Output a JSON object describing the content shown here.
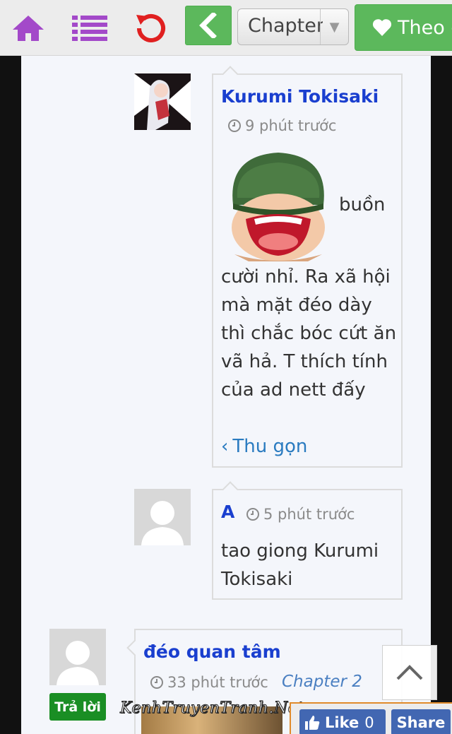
{
  "toolbar": {
    "home_icon": "home-icon",
    "list_icon": "list-icon",
    "reload_icon": "reload-icon",
    "back_icon": "chevron-left-icon",
    "chapter_select_value": "Chapter",
    "follow_label": "Theo dõi",
    "colors": {
      "icon_purple": "#a349c9",
      "reload_red": "#e02020",
      "green": "#5cb85c"
    }
  },
  "comments": [
    {
      "author": "Kurumi Tokisaki",
      "time": "9 phút trước",
      "sticker_label": "buồn",
      "text": "cười nhỉ. Ra xã hội mà mặt đéo dày thì chắc bóc cứt ăn vã hả. T thích tính của ad nett đấy",
      "collapse_label": "Thu gọn"
    },
    {
      "author": "A",
      "time": "5 phút trước",
      "text": "tao giong Kurumi Tokisaki"
    },
    {
      "author": "đéo quan tâm",
      "time": "33 phút trước",
      "chapter": "Chapter 2",
      "reply_label": "Trả lời"
    }
  ],
  "watermark": "KenhTruyenTranh.Net",
  "facebook": {
    "like_label": "Like",
    "like_count": "0",
    "share_label": "Share"
  },
  "colors": {
    "author_blue": "#1a3fcf",
    "reply_green": "#1a8e24",
    "fb_blue": "#4267b2",
    "link_blue": "#2a7bc0"
  }
}
